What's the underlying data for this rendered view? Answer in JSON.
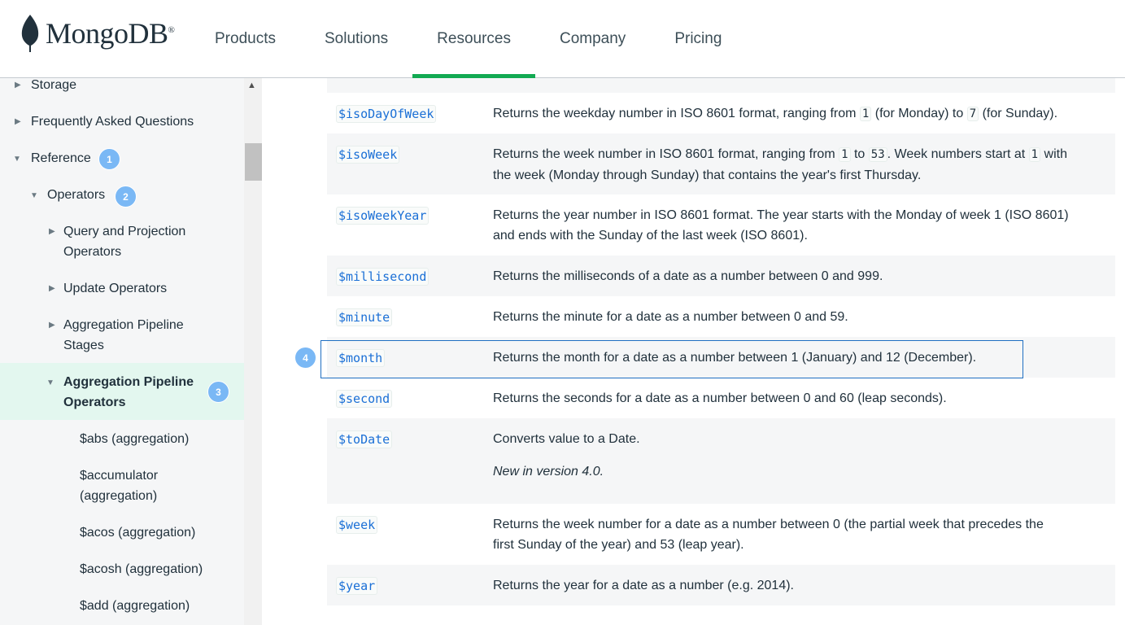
{
  "brand": {
    "name": "MongoDB",
    "mark": "®"
  },
  "nav": [
    "Products",
    "Solutions",
    "Resources",
    "Company",
    "Pricing"
  ],
  "sidebar": {
    "storage": "Storage",
    "faq": "Frequently Asked Questions",
    "reference": "Reference",
    "operators": "Operators",
    "query_l1": "Query and Projection",
    "query_l2": "Operators",
    "update": "Update Operators",
    "stages_l1": "Aggregation Pipeline",
    "stages_l2": "Stages",
    "agg_ops_l1": "Aggregation Pipeline",
    "agg_ops_l2": "Operators",
    "abs": "$abs (aggregation)",
    "accumulator_l1": "$accumulator",
    "accumulator_l2": "(aggregation)",
    "acos": "$acos (aggregation)",
    "acosh": "$acosh (aggregation)",
    "add": "$add (aggregation)"
  },
  "badges": {
    "b1": "1",
    "b2": "2",
    "b3": "3",
    "b4": "4"
  },
  "rows": [
    {
      "op": "$isoDayOfWeek",
      "d1": "Returns the weekday number in ISO 8601 format, ranging from ",
      "c1": "1",
      "d2": " (for Monday) to ",
      "c2": "7",
      "d3": " (for Sunday)."
    },
    {
      "op": "$isoWeek",
      "d1": "Returns the week number in ISO 8601 format, ranging from ",
      "c1": "1",
      "d2": " to ",
      "c2": "53",
      "d3": ". Week numbers start at ",
      "c3": "1",
      "d4": " with",
      "line2": "the week (Monday through Sunday) that contains the year's first Thursday."
    },
    {
      "op": "$isoWeekYear",
      "line1": "Returns the year number in ISO 8601 format. The year starts with the Monday of week 1 (ISO 8601)",
      "line2": "and ends with the Sunday of the last week (ISO 8601)."
    },
    {
      "op": "$millisecond",
      "line1": "Returns the milliseconds of a date as a number between 0 and 999."
    },
    {
      "op": "$minute",
      "line1": "Returns the minute for a date as a number between 0 and 59."
    },
    {
      "op": "$month",
      "line1": "Returns the month for a date as a number between 1 (January) and 12 (December)."
    },
    {
      "op": "$second",
      "line1": "Returns the seconds for a date as a number between 0 and 60 (leap seconds)."
    },
    {
      "op": "$toDate",
      "line1": "Converts value to a Date.",
      "note": "New in version 4.0."
    },
    {
      "op": "$week",
      "line1": "Returns the week number for a date as a number between 0 (the partial week that precedes the",
      "line2": "first Sunday of the year) and 53 (leap year)."
    },
    {
      "op": "$year",
      "line1": "Returns the year for a date as a number (e.g. 2014)."
    }
  ],
  "colors": {
    "accent": "#13aa52",
    "link": "#1a6fd6",
    "badge": "#7ab8f5",
    "active_bg": "#e3f7ef"
  }
}
